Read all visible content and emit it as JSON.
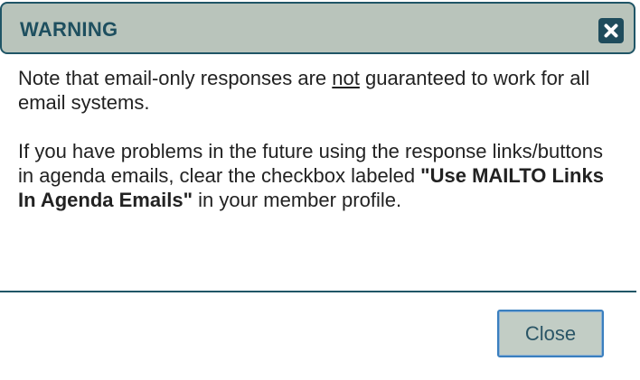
{
  "dialog": {
    "title": "WARNING",
    "close_icon": "close-x-icon",
    "paragraph1": {
      "before": "Note that email-only responses are ",
      "emphasis": "not",
      "after": " guaranteed to work for all email systems."
    },
    "paragraph2": {
      "before": "If you have problems in the future using the response links/buttons in agenda emails, clear the checkbox labeled ",
      "bold": "\"Use MAILTO Links In Agenda Emails\"",
      "after": " in your member profile."
    },
    "close_button_label": "Close"
  },
  "colors": {
    "title_bar_bg": "#b9c4bb",
    "title_text": "#1e4f5f",
    "border": "#1f5566",
    "button_bg": "#c2cdc5",
    "button_border": "#3a7fbf"
  }
}
